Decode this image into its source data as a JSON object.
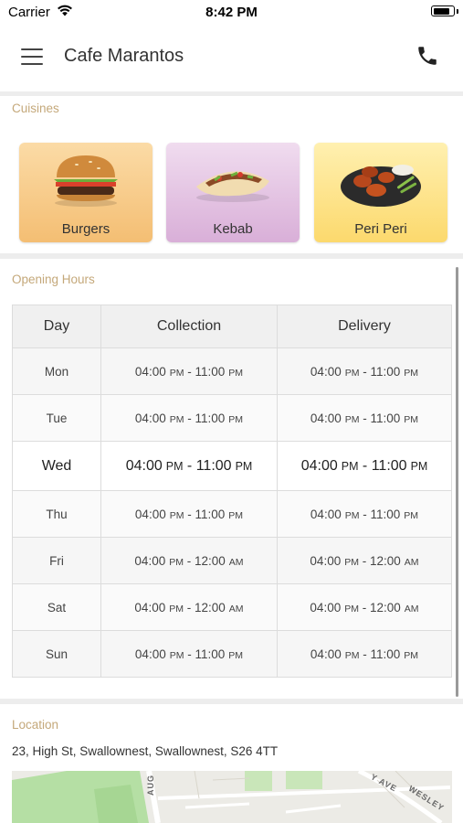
{
  "status_bar": {
    "carrier": "Carrier",
    "time": "8:42 PM",
    "battery_level": 0.85
  },
  "header": {
    "title": "Cafe Marantos",
    "menu_icon": "hamburger-menu-icon",
    "call_icon": "phone-icon"
  },
  "cuisines": {
    "label": "Cuisines",
    "items": [
      {
        "label": "Burgers",
        "color": "#f6c98a"
      },
      {
        "label": "Kebab",
        "color": "#e2bfe0"
      },
      {
        "label": "Peri Peri",
        "color": "#fde08e"
      }
    ]
  },
  "opening_hours": {
    "label": "Opening Hours",
    "columns": [
      "Day",
      "Collection",
      "Delivery"
    ],
    "rows": [
      {
        "day": "Mon",
        "collection": [
          "04:00",
          "PM",
          " - 11:00",
          "PM"
        ],
        "delivery": [
          "04:00",
          "PM",
          " - 11:00",
          "PM"
        ]
      },
      {
        "day": "Tue",
        "collection": [
          "04:00",
          "PM",
          " - 11:00",
          "PM"
        ],
        "delivery": [
          "04:00",
          "PM",
          " - 11:00",
          "PM"
        ]
      },
      {
        "day": "Wed",
        "collection": [
          "04:00",
          "PM",
          " - 11:00",
          "PM"
        ],
        "delivery": [
          "04:00",
          "PM",
          " - 11:00",
          "PM"
        ]
      },
      {
        "day": "Thu",
        "collection": [
          "04:00",
          "PM",
          " - 11:00",
          "PM"
        ],
        "delivery": [
          "04:00",
          "PM",
          " - 11:00",
          "PM"
        ]
      },
      {
        "day": "Fri",
        "collection": [
          "04:00",
          "PM",
          " - 12:00",
          "AM"
        ],
        "delivery": [
          "04:00",
          "PM",
          " - 12:00",
          "AM"
        ]
      },
      {
        "day": "Sat",
        "collection": [
          "04:00",
          "PM",
          " - 12:00",
          "AM"
        ],
        "delivery": [
          "04:00",
          "PM",
          " - 12:00",
          "AM"
        ]
      },
      {
        "day": "Sun",
        "collection": [
          "04:00",
          "PM",
          " - 11:00",
          "PM"
        ],
        "delivery": [
          "04:00",
          "PM",
          " - 11:00",
          "PM"
        ]
      }
    ]
  },
  "location": {
    "label": "Location",
    "address": "23, High St, Swallownest, Swallownest, S26 4TT",
    "map_labels": [
      "AUG",
      "Y AVE",
      "WESLEY"
    ]
  },
  "colors": {
    "section_label": "#c4a87a",
    "divider": "#ededed"
  }
}
